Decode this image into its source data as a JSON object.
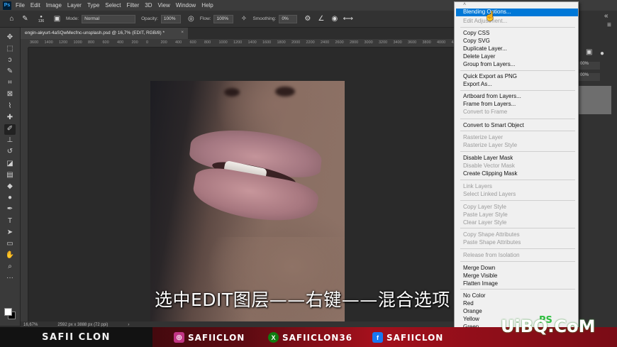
{
  "app": {
    "logo": "Ps",
    "menu": [
      "File",
      "Edit",
      "Image",
      "Layer",
      "Type",
      "Select",
      "Filter",
      "3D",
      "View",
      "Window",
      "Help"
    ]
  },
  "options_bar": {
    "brush_size": "136",
    "mode_label": "Mode:",
    "mode_value": "Normal",
    "opacity_label": "Opacity:",
    "opacity_value": "100%",
    "flow_label": "Flow:",
    "flow_value": "100%",
    "smoothing_label": "Smoothing:",
    "smoothing_value": "0%"
  },
  "document": {
    "tab_title": "engin-akyurt-4aSQwMecfnc-unsplash.psd @ 16,7% (EDIT, RGB/8) *",
    "ruler_ticks": [
      "3600",
      "1400",
      "1200",
      "1000",
      "800",
      "600",
      "400",
      "200",
      "0",
      "200",
      "400",
      "600",
      "800",
      "1000",
      "1200",
      "1400",
      "1600",
      "1800",
      "2000",
      "2200",
      "2400",
      "2600",
      "2800",
      "3000",
      "3200",
      "3400",
      "3600",
      "3800",
      "4000",
      "4200"
    ],
    "zoom": "16,67%",
    "dimensions": "2592 px x 3888 px (72 ppi)"
  },
  "subtitle": "选中EDIT图层——右键——混合选项",
  "context_menu": {
    "items": [
      {
        "label": "Blending Options...",
        "enabled": true,
        "highlighted": true
      },
      {
        "label": "Edit Adjustment...",
        "enabled": false
      },
      {
        "label": "Copy CSS",
        "enabled": true
      },
      {
        "label": "Copy SVG",
        "enabled": true
      },
      {
        "label": "Duplicate Layer...",
        "enabled": true
      },
      {
        "label": "Delete Layer",
        "enabled": true
      },
      {
        "label": "Group from Layers...",
        "enabled": true
      },
      {
        "label": "Quick Export as PNG",
        "enabled": true
      },
      {
        "label": "Export As...",
        "enabled": true
      },
      {
        "label": "Artboard from Layers...",
        "enabled": true
      },
      {
        "label": "Frame from Layers...",
        "enabled": true
      },
      {
        "label": "Convert to Frame",
        "enabled": false
      },
      {
        "label": "Convert to Smart Object",
        "enabled": true
      },
      {
        "label": "Rasterize Layer",
        "enabled": false
      },
      {
        "label": "Rasterize Layer Style",
        "enabled": false
      },
      {
        "label": "Disable Layer Mask",
        "enabled": true
      },
      {
        "label": "Disable Vector Mask",
        "enabled": false
      },
      {
        "label": "Create Clipping Mask",
        "enabled": true
      },
      {
        "label": "Link Layers",
        "enabled": false
      },
      {
        "label": "Select Linked Layers",
        "enabled": false
      },
      {
        "label": "Copy Layer Style",
        "enabled": false
      },
      {
        "label": "Paste Layer Style",
        "enabled": false
      },
      {
        "label": "Clear Layer Style",
        "enabled": false
      },
      {
        "label": "Copy Shape Attributes",
        "enabled": false
      },
      {
        "label": "Paste Shape Attributes",
        "enabled": false
      },
      {
        "label": "Release from Isolation",
        "enabled": false
      },
      {
        "label": "Merge Down",
        "enabled": true
      },
      {
        "label": "Merge Visible",
        "enabled": true
      },
      {
        "label": "Flatten Image",
        "enabled": true
      },
      {
        "label": "No Color",
        "enabled": true
      },
      {
        "label": "Red",
        "enabled": true
      },
      {
        "label": "Orange",
        "enabled": true
      },
      {
        "label": "Yellow",
        "enabled": true
      },
      {
        "label": "Green",
        "enabled": true
      }
    ]
  },
  "right_panel": {
    "field1": "00%",
    "field2": "00%"
  },
  "banner": {
    "name": "SAFII CLON",
    "instagram": "SAFIICLON",
    "xbox": "SAFIICLON36",
    "facebook": "SAFIICLON"
  },
  "watermark": {
    "main": "UiBQ.CoM",
    "ps": "PS"
  },
  "colors": {
    "highlight": "#0078d7",
    "banner_red": "#a3101c",
    "instagram": "#c13584",
    "xbox": "#107c10",
    "facebook": "#1877f2"
  }
}
